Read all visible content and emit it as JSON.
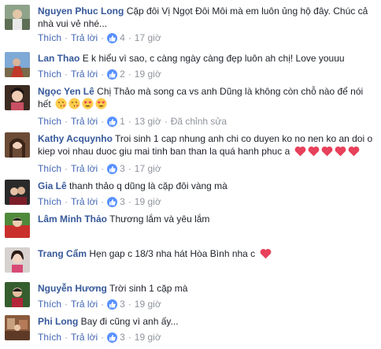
{
  "labels": {
    "like": "Thích",
    "reply": "Trả lời",
    "edited": "Đã chỉnh sửa"
  },
  "colors": {
    "name": "#365899",
    "link": "#4267b2",
    "muted": "#90949c",
    "like_badge": "#5890ff",
    "heart": "#e8415b"
  },
  "comments": [
    {
      "name": "Nguyen Phuc Long",
      "text_lines": [
        "Cặp đôi Vị Ngọt Đôi Môi mà em luôn ủng hộ đây. Chúc cả",
        "nhà vui vẻ nhé..."
      ],
      "likes": "4",
      "time": "17 giờ"
    },
    {
      "name": "Lan Thao",
      "text_lines": [
        "E k hiểu vì sao, c càng ngày càng đẹp luôn ah chị! Love youuu"
      ],
      "likes": "2",
      "time": "19 giờ"
    },
    {
      "name": "Ngọc Yen Lê",
      "text_lines": [
        "Chị Thảo mà song ca vs anh Dũng là không còn chỗ nào để nói",
        "hết"
      ],
      "emoji": [
        "kiss-emoji",
        "kiss-emoji",
        "heart-eyes-emoji",
        "heart-eyes-emoji"
      ],
      "likes": "1",
      "time": "13 giờ",
      "edited": true
    },
    {
      "name": "Kathy Acquynho",
      "text_lines": [
        "Troi sinh 1 cap nhung anh chi co duyen ko no nen ko an doi o",
        "kiep voi nhau duoc giu mai tinh ban than la quá hanh phuc a"
      ],
      "hearts": 5,
      "likes": "3",
      "time": "17 giờ"
    },
    {
      "name": "Gia Lê",
      "text_lines": [
        "thanh thảo q dũng là cặp đôi vàng mà"
      ],
      "likes": "3",
      "time": "19 giờ"
    },
    {
      "name": "Lâm Minh Thảo",
      "text_lines": [
        "Thương lắm và yêu lắm"
      ]
    },
    {
      "name": "Trang Cẩm",
      "text_lines": [
        "Hẹn gap c 18/3 nha hát Hòa Bình nha c"
      ],
      "hearts": 1
    },
    {
      "name": "Nguyễn Hương",
      "text_lines": [
        "Trời sinh 1 cặp mà"
      ],
      "likes": "3",
      "time": "19 giờ"
    },
    {
      "name": "Phi Long",
      "text_lines": [
        "Bay đi cũng vì anh ấy..."
      ],
      "likes": "3",
      "time": "19 giờ"
    }
  ]
}
